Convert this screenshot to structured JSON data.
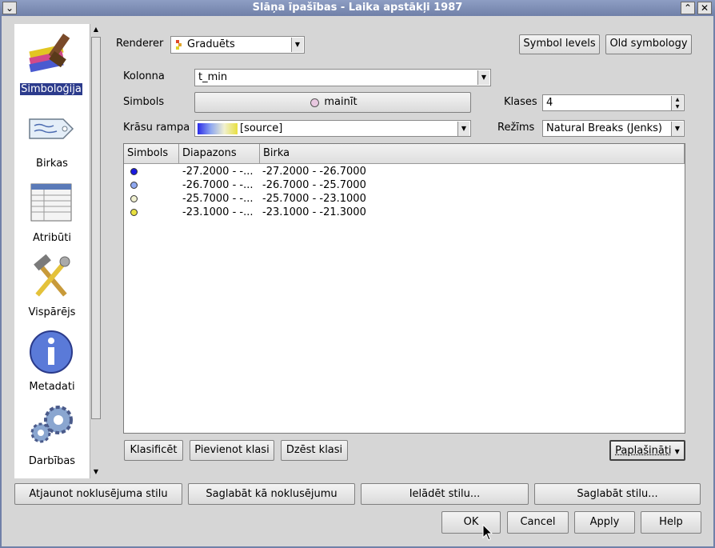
{
  "window": {
    "title": "Slāņa īpašības - Laika apstākļi 1987"
  },
  "nav": [
    {
      "label": "Simboloģija",
      "icon": "symbology-brush-icon"
    },
    {
      "label": "Birkas",
      "icon": "label-tag-icon"
    },
    {
      "label": "Atribūti",
      "icon": "attribute-table-icon"
    },
    {
      "label": "Vispārējs",
      "icon": "general-tools-icon"
    },
    {
      "label": "Metadati",
      "icon": "info-icon"
    },
    {
      "label": "Darbības",
      "icon": "actions-gear-icon"
    }
  ],
  "symbology": {
    "renderer_label": "Renderer",
    "renderer_value": "Graduēts",
    "symbol_levels": "Symbol levels",
    "old_symbology": "Old symbology",
    "column_label": "Kolonna",
    "column_value": "t_min",
    "symbol_label": "Simbols",
    "symbol_button": "mainīt",
    "classes_label": "Klases",
    "classes_value": "4",
    "ramp_label": "Krāsu rampa",
    "ramp_value": "[source]",
    "mode_label": "Režīms",
    "mode_value": "Natural Breaks (Jenks)"
  },
  "table": {
    "headers": [
      "Simbols",
      "Diapazons",
      "Birka"
    ],
    "rows": [
      {
        "color": "#1a1ae0",
        "range": "-27.2000 - -...",
        "label": "-27.2000 - -26.7000"
      },
      {
        "color": "#8fa8f0",
        "range": "-26.7000 - -...",
        "label": "-26.7000 - -25.7000"
      },
      {
        "color": "#f0f0d0",
        "range": "-25.7000 - -...",
        "label": "-25.7000 - -23.1000"
      },
      {
        "color": "#e8e040",
        "range": "-23.1000 - -...",
        "label": "-23.1000 - -21.3000"
      }
    ]
  },
  "class_buttons": {
    "classify": "Klasificēt",
    "add": "Pievienot klasi",
    "delete": "Dzēst klasi",
    "advanced": "Paplašināti"
  },
  "style_buttons": {
    "restore": "Atjaunot noklusējuma stilu",
    "save_default": "Saglabāt kā noklusējumu",
    "load": "Ielādēt stilu...",
    "save": "Saglabāt stilu..."
  },
  "dialog_buttons": {
    "ok": "OK",
    "cancel": "Cancel",
    "apply": "Apply",
    "help": "Help"
  }
}
